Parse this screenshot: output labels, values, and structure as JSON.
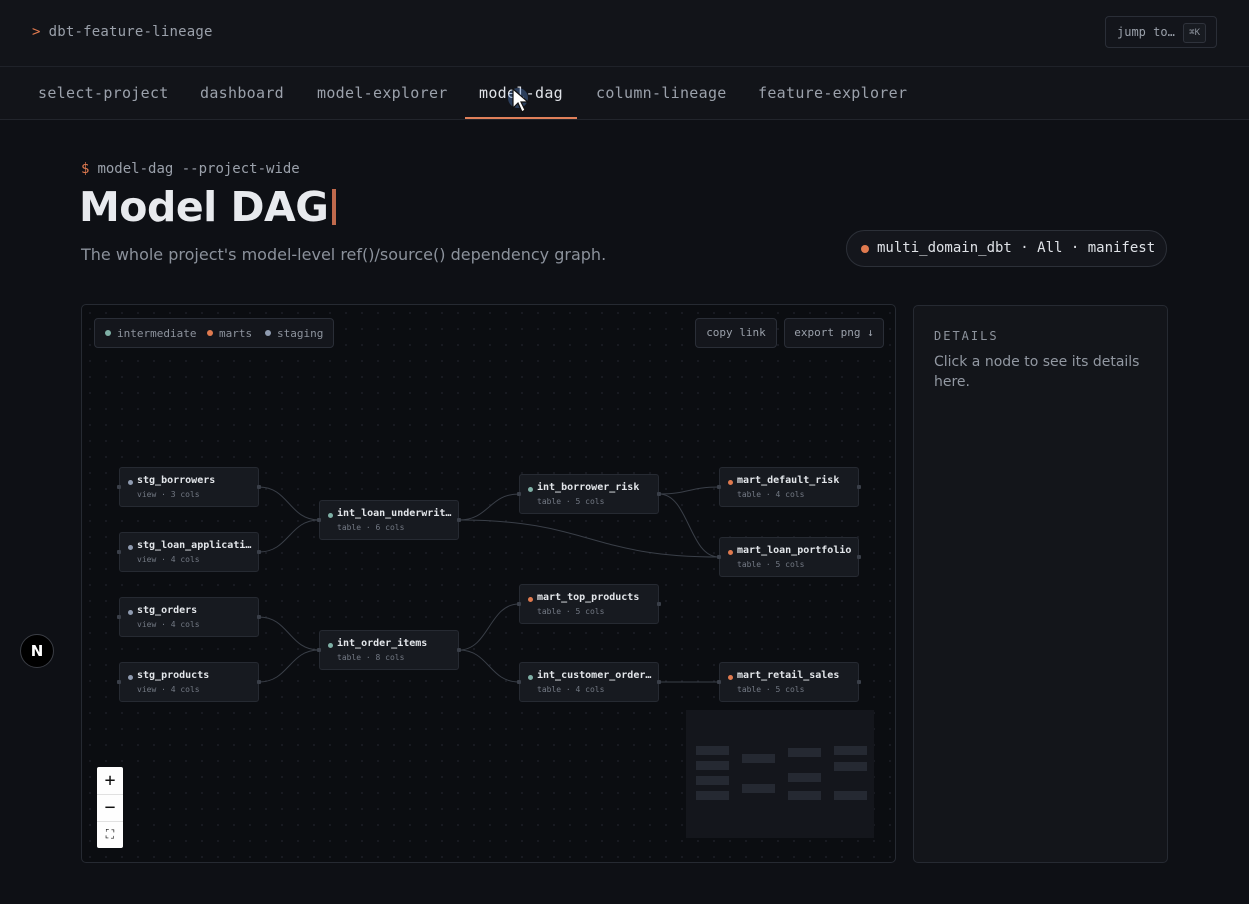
{
  "app": {
    "title": "dbt-feature-lineage",
    "prompt_symbol": ">"
  },
  "jump": {
    "label": "jump to…",
    "shortcut": "⌘K"
  },
  "tabs": [
    {
      "label": "select-project",
      "active": false
    },
    {
      "label": "dashboard",
      "active": false
    },
    {
      "label": "model-explorer",
      "active": false
    },
    {
      "label": "model-dag",
      "active": true
    },
    {
      "label": "column-lineage",
      "active": false
    },
    {
      "label": "feature-explorer",
      "active": false
    }
  ],
  "page": {
    "prompt_symbol": "$",
    "command": "model-dag --project-wide",
    "title": "Model DAG",
    "subtitle": "The whole project's model-level ref()/source() dependency graph."
  },
  "project_pill": {
    "text": "multi_domain_dbt · All · manifest",
    "dot_color": "#e07a4f"
  },
  "legend": [
    {
      "label": "intermediate",
      "color": "#7fb0a6"
    },
    {
      "label": "marts",
      "color": "#e07a4f"
    },
    {
      "label": "staging",
      "color": "#8f9bb0"
    }
  ],
  "graph_actions": {
    "copy_link": "copy link",
    "export_png": "export png ↓"
  },
  "nodes": [
    {
      "id": "stg_borrowers",
      "name": "stg_borrowers",
      "meta": "view · 3 cols",
      "layer": "staging"
    },
    {
      "id": "stg_loan_applications",
      "name": "stg_loan_applicati…",
      "meta": "view · 4 cols",
      "layer": "staging"
    },
    {
      "id": "stg_orders",
      "name": "stg_orders",
      "meta": "view · 4 cols",
      "layer": "staging"
    },
    {
      "id": "stg_products",
      "name": "stg_products",
      "meta": "view · 4 cols",
      "layer": "staging"
    },
    {
      "id": "int_loan_underwriting",
      "name": "int_loan_underwrit…",
      "meta": "table · 6 cols",
      "layer": "intermediate"
    },
    {
      "id": "int_order_items",
      "name": "int_order_items",
      "meta": "table · 8 cols",
      "layer": "intermediate"
    },
    {
      "id": "int_borrower_risk",
      "name": "int_borrower_risk",
      "meta": "table · 5 cols",
      "layer": "intermediate"
    },
    {
      "id": "mart_top_products",
      "name": "mart_top_products",
      "meta": "table · 5 cols",
      "layer": "marts"
    },
    {
      "id": "int_customer_orders",
      "name": "int_customer_order…",
      "meta": "table · 4 cols",
      "layer": "intermediate"
    },
    {
      "id": "mart_default_risk",
      "name": "mart_default_risk",
      "meta": "table · 4 cols",
      "layer": "marts"
    },
    {
      "id": "mart_loan_portfolio",
      "name": "mart_loan_portfolio",
      "meta": "table · 5 cols",
      "layer": "marts"
    },
    {
      "id": "mart_retail_sales",
      "name": "mart_retail_sales",
      "meta": "table · 5 cols",
      "layer": "marts"
    }
  ],
  "edges": [
    [
      "stg_borrowers",
      "int_loan_underwriting"
    ],
    [
      "stg_loan_applications",
      "int_loan_underwriting"
    ],
    [
      "int_loan_underwriting",
      "int_borrower_risk"
    ],
    [
      "int_loan_underwriting",
      "mart_loan_portfolio"
    ],
    [
      "int_borrower_risk",
      "mart_default_risk"
    ],
    [
      "int_borrower_risk",
      "mart_loan_portfolio"
    ],
    [
      "stg_orders",
      "int_order_items"
    ],
    [
      "stg_products",
      "int_order_items"
    ],
    [
      "int_order_items",
      "mart_top_products"
    ],
    [
      "int_order_items",
      "int_customer_orders"
    ],
    [
      "int_customer_orders",
      "mart_retail_sales"
    ]
  ],
  "zoom_controls": {
    "zoom_in": "+",
    "zoom_out": "−",
    "fit": "⛶"
  },
  "details": {
    "heading": "DETAILS",
    "text": "Click a node to see its details here."
  },
  "badge": {
    "letter": "N"
  }
}
